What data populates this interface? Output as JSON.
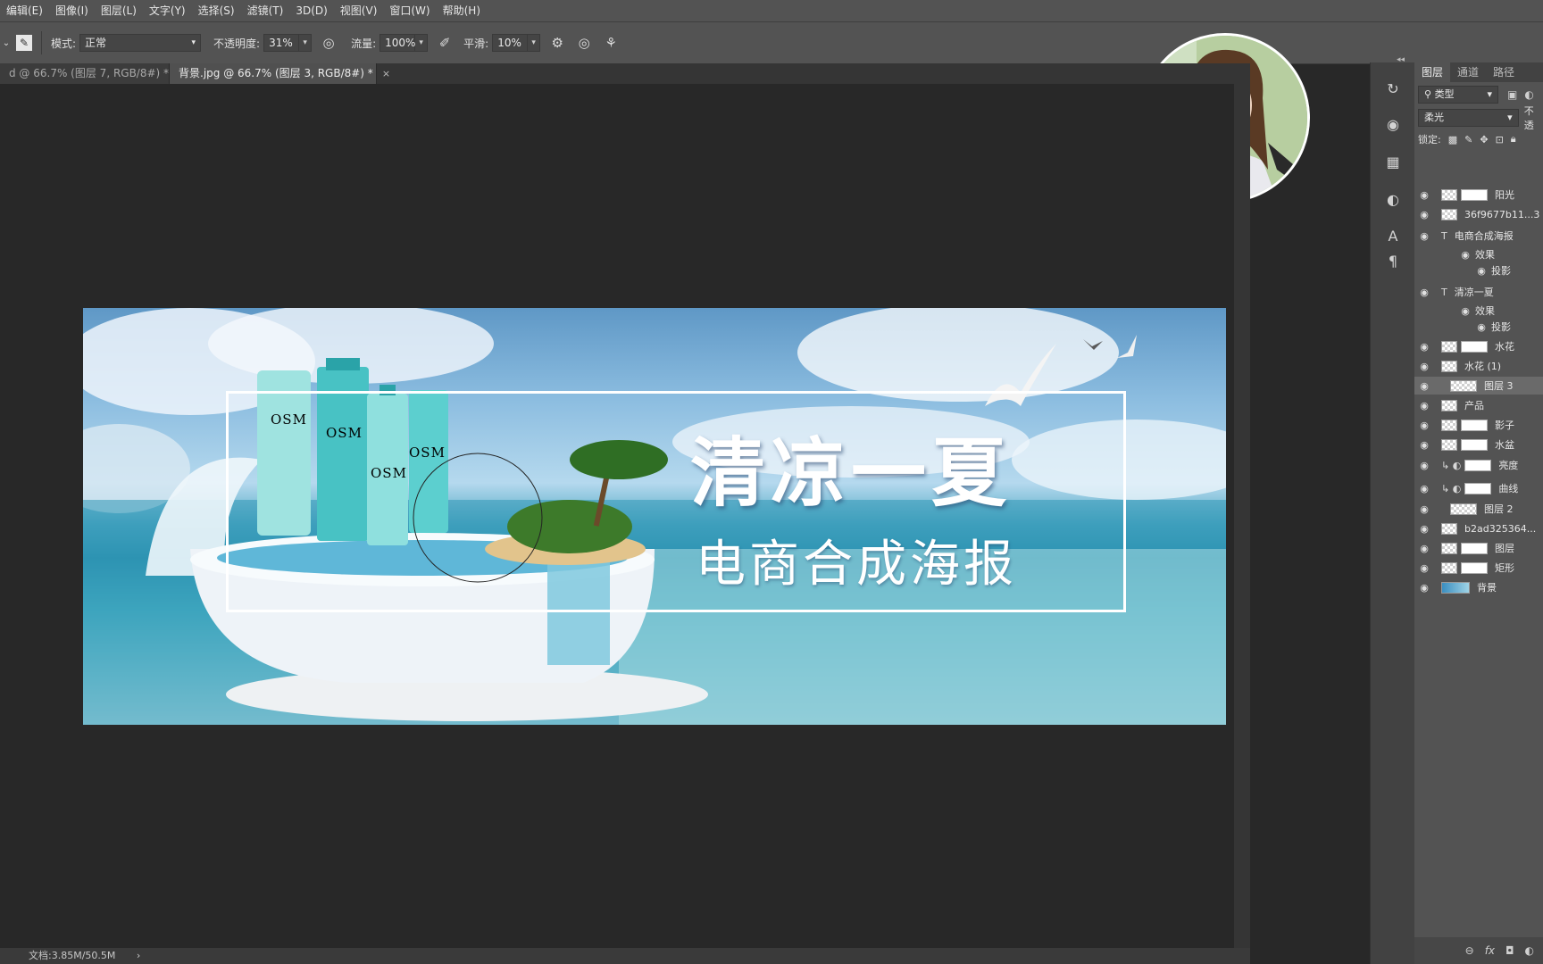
{
  "menu": [
    "编辑(E)",
    "图像(I)",
    "图层(L)",
    "文字(Y)",
    "选择(S)",
    "滤镜(T)",
    "3D(D)",
    "视图(V)",
    "窗口(W)",
    "帮助(H)"
  ],
  "options": {
    "mode_label": "模式:",
    "mode_value": "正常",
    "opacity_label": "不透明度:",
    "opacity_value": "31%",
    "flow_label": "流量:",
    "flow_value": "100%",
    "smoothing_label": "平滑:",
    "smoothing_value": "10%"
  },
  "tabs": [
    {
      "label": "d @ 66.7% (图层 7, RGB/8#) *",
      "close": "×",
      "active": false
    },
    {
      "label": "背景.jpg @ 66.7% (图层 3, RGB/8#) *",
      "close": "×",
      "active": true
    }
  ],
  "poster": {
    "title": "清凉一夏",
    "subtitle": "电商合成海报",
    "brand": "OSM"
  },
  "status": {
    "doc_info": "文档:3.85M/50.5M",
    "arrow": "›"
  },
  "panel": {
    "tabs": [
      "图层",
      "通道",
      "路径"
    ],
    "filter_label": "类型",
    "blend_mode": "柔光",
    "opacity_short": "不透",
    "lock_label": "锁定:"
  },
  "layers": [
    {
      "name": "阳光",
      "kind": "mask"
    },
    {
      "name": "36f9677b11...3",
      "kind": "smart"
    },
    {
      "name": "电商合成海报",
      "kind": "text"
    },
    {
      "name": "效果",
      "kind": "effect"
    },
    {
      "name": "投影",
      "kind": "subeffect"
    },
    {
      "name": "清凉一夏",
      "kind": "text"
    },
    {
      "name": "效果",
      "kind": "effect"
    },
    {
      "name": "投影",
      "kind": "subeffect"
    },
    {
      "name": "水花",
      "kind": "mask"
    },
    {
      "name": "水花 (1)",
      "kind": "smart"
    },
    {
      "name": "图层 3",
      "kind": "clip-selected"
    },
    {
      "name": "产品",
      "kind": "smart"
    },
    {
      "name": "影子",
      "kind": "mask"
    },
    {
      "name": "水盆",
      "kind": "mask"
    },
    {
      "name": "亮度",
      "kind": "adjust"
    },
    {
      "name": "曲线",
      "kind": "adjust"
    },
    {
      "name": "图层 2",
      "kind": "clip"
    },
    {
      "name": "b2ad325364...",
      "kind": "smart"
    },
    {
      "name": "图层",
      "kind": "mask"
    },
    {
      "name": "矩形",
      "kind": "mask"
    },
    {
      "name": "背景",
      "kind": "background"
    }
  ],
  "footer_icons": [
    "link-icon",
    "fx-icon",
    "mask-icon",
    "adjustment-icon"
  ],
  "footer_glyphs": [
    "⊖",
    "fx",
    "◘",
    "◐"
  ]
}
